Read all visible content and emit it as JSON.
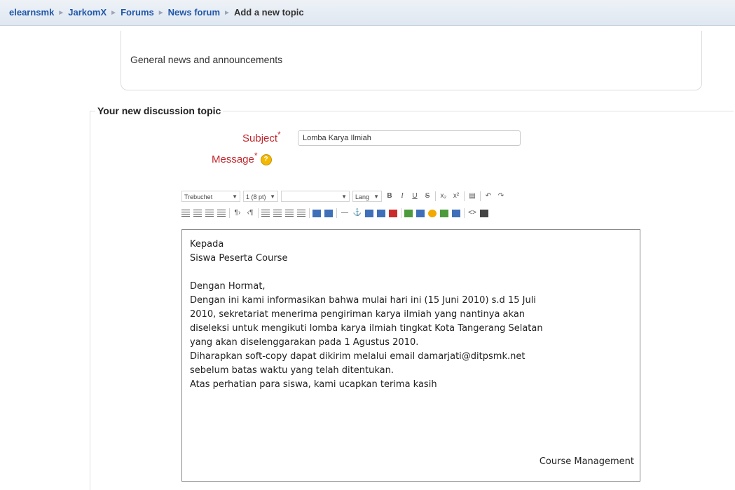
{
  "breadcrumb": {
    "items": [
      "elearnsmk",
      "JarkomX",
      "Forums",
      "News forum"
    ],
    "current": "Add a new topic",
    "separator": "►"
  },
  "forum": {
    "intro": "General news and announcements"
  },
  "form": {
    "legend": "Your new discussion topic",
    "subject_label": "Subject",
    "subject_value": "Lomba Karya Ilmiah",
    "message_label": "Message",
    "required_mark": "*",
    "help_icon": "?"
  },
  "toolbar": {
    "font_family": "Trebuchet",
    "font_size": "1 (8 pt)",
    "heading": "",
    "lang": "Lang"
  },
  "message": {
    "lines": [
      "Kepada",
      "Siswa Peserta Course",
      "",
      "Dengan Hormat,",
      "Dengan ini kami informasikan bahwa mulai hari ini (15 Juni 2010) s.d 15 Juli",
      "2010, sekretariat menerima pengiriman karya ilmiah yang nantinya akan",
      "diseleksi untuk mengikuti lomba karya ilmiah tingkat Kota Tangerang Selatan",
      "yang akan diselenggarakan pada 1 Agustus 2010.",
      "Diharapkan soft-copy dapat dikirim melalui email damarjati@ditpsmk.net",
      "sebelum batas waktu yang telah ditentukan.",
      "Atas perhatian para siswa, kami ucapkan terima kasih"
    ],
    "signature": "Course Management"
  }
}
